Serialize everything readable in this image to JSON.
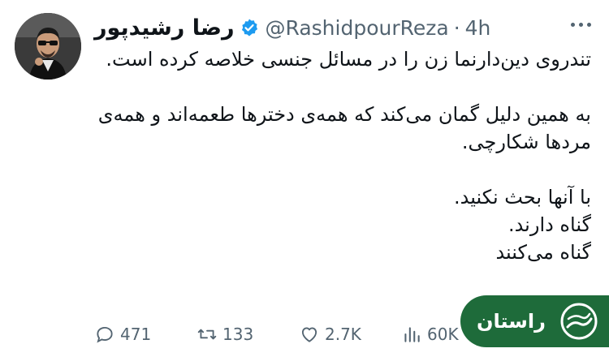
{
  "author": {
    "name": "رضا رشیدپور",
    "handle": "@RashidpourReza",
    "time": "4h",
    "verified_color": "#1d9bf0"
  },
  "tweet": {
    "paragraphs": [
      "تندروی دین‌دارنما زن را در مسائل جنسی خلاصه کرده است.",
      "",
      "به همین دلیل گمان می‌کند که همه‌ی دخترها طعمه‌اند و همه‌ی مردها شکارچی.",
      "",
      "با آنها بحث نکنید.",
      "گناه دارند.",
      "گناه می‌کنند"
    ]
  },
  "actions": {
    "replies": "471",
    "retweets": "133",
    "likes": "2.7K",
    "views": "60K"
  },
  "watermark": {
    "text": "راستان",
    "color": "#1e6b3a"
  },
  "icons": [
    "verified-badge-icon",
    "more-icon",
    "reply-icon",
    "retweet-icon",
    "like-icon",
    "views-icon"
  ]
}
